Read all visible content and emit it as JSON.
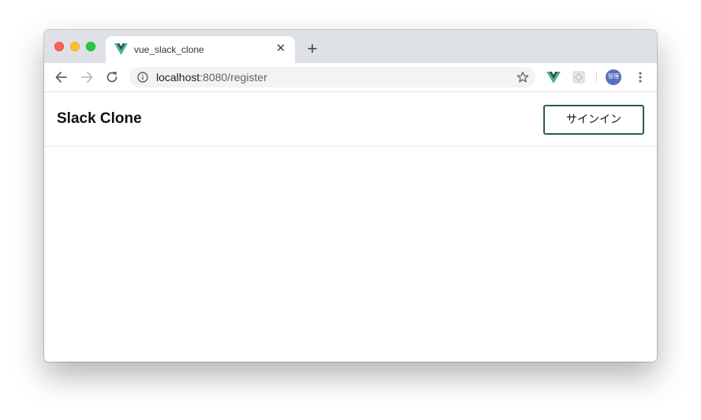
{
  "browser": {
    "tab": {
      "title": "vue_slack_clone",
      "favicon": "vue-logo-icon",
      "close_glyph": "✕"
    },
    "new_tab_glyph": "+",
    "address": {
      "host": "localhost",
      "path": ":8080/register"
    },
    "profile_avatar_text": "管理",
    "icons": [
      "back-arrow-icon",
      "forward-arrow-icon",
      "reload-icon",
      "info-icon",
      "star-icon",
      "vue-devtools-icon",
      "extension-icon",
      "more-vert-icon"
    ]
  },
  "app": {
    "brand": "Slack Clone",
    "signin_label": "サインイン",
    "accent": "#2b5e4c"
  }
}
